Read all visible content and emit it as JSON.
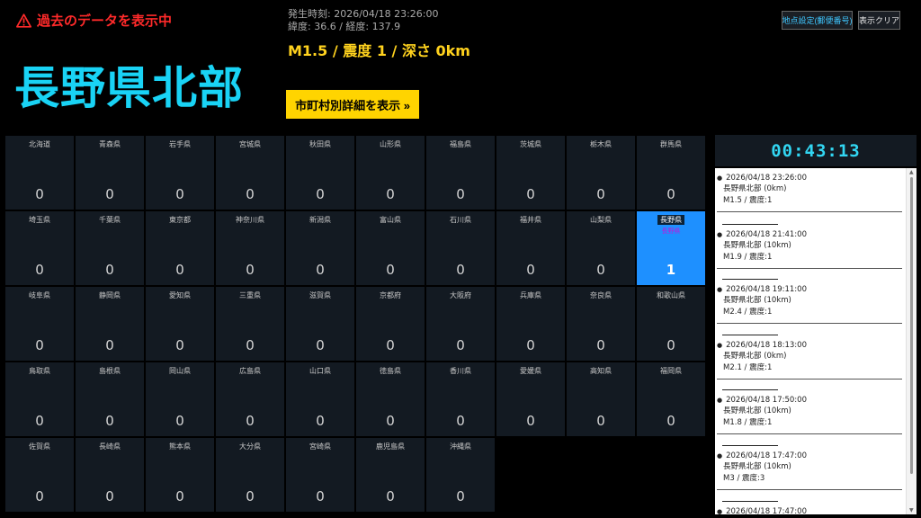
{
  "header": {
    "warning": "過去のデータを表示中",
    "region_title": "長野県北部",
    "time_line": "発生時刻: 2026/04/18 23:26:00",
    "coord_line": "緯度: 36.6 / 経度: 137.9",
    "quake_line": "M1.5 / 震度 1 / 深さ 0km",
    "detail_button": "市町村別詳細を表示 »",
    "postal_button": "地点設定(郵便番号)",
    "clear_button": "表示クリア"
  },
  "grid": [
    {
      "name": "北海道",
      "count": "0"
    },
    {
      "name": "青森県",
      "count": "0"
    },
    {
      "name": "岩手県",
      "count": "0"
    },
    {
      "name": "宮城県",
      "count": "0"
    },
    {
      "name": "秋田県",
      "count": "0"
    },
    {
      "name": "山形県",
      "count": "0"
    },
    {
      "name": "福島県",
      "count": "0"
    },
    {
      "name": "茨城県",
      "count": "0"
    },
    {
      "name": "栃木県",
      "count": "0"
    },
    {
      "name": "群馬県",
      "count": "0"
    },
    {
      "name": "埼玉県",
      "count": "0"
    },
    {
      "name": "千葉県",
      "count": "0"
    },
    {
      "name": "東京都",
      "count": "0"
    },
    {
      "name": "神奈川県",
      "count": "0"
    },
    {
      "name": "新潟県",
      "count": "0"
    },
    {
      "name": "富山県",
      "count": "0"
    },
    {
      "name": "石川県",
      "count": "0"
    },
    {
      "name": "福井県",
      "count": "0"
    },
    {
      "name": "山梨県",
      "count": "0"
    },
    {
      "name": "長野県",
      "count": "1",
      "sub": "長野県",
      "highlight": true
    },
    {
      "name": "岐阜県",
      "count": "0"
    },
    {
      "name": "静岡県",
      "count": "0"
    },
    {
      "name": "愛知県",
      "count": "0"
    },
    {
      "name": "三重県",
      "count": "0"
    },
    {
      "name": "滋賀県",
      "count": "0"
    },
    {
      "name": "京都府",
      "count": "0"
    },
    {
      "name": "大阪府",
      "count": "0"
    },
    {
      "name": "兵庫県",
      "count": "0"
    },
    {
      "name": "奈良県",
      "count": "0"
    },
    {
      "name": "和歌山県",
      "count": "0"
    },
    {
      "name": "鳥取県",
      "count": "0"
    },
    {
      "name": "島根県",
      "count": "0"
    },
    {
      "name": "岡山県",
      "count": "0"
    },
    {
      "name": "広島県",
      "count": "0"
    },
    {
      "name": "山口県",
      "count": "0"
    },
    {
      "name": "徳島県",
      "count": "0"
    },
    {
      "name": "香川県",
      "count": "0"
    },
    {
      "name": "愛媛県",
      "count": "0"
    },
    {
      "name": "高知県",
      "count": "0"
    },
    {
      "name": "福岡県",
      "count": "0"
    },
    {
      "name": "佐賀県",
      "count": "0"
    },
    {
      "name": "長崎県",
      "count": "0"
    },
    {
      "name": "熊本県",
      "count": "0"
    },
    {
      "name": "大分県",
      "count": "0"
    },
    {
      "name": "宮崎県",
      "count": "0"
    },
    {
      "name": "鹿児島県",
      "count": "0"
    },
    {
      "name": "沖縄県",
      "count": "0"
    }
  ],
  "timer": "00:43:13",
  "log": [
    {
      "time": "2026/04/18 23:26:00",
      "place": "長野県北部 (0km)",
      "info": "M1.5 / 震度:1"
    },
    {
      "time": "2026/04/18 21:41:00",
      "place": "長野県北部 (10km)",
      "info": "M1.9 / 震度:1"
    },
    {
      "time": "2026/04/18 19:11:00",
      "place": "長野県北部 (10km)",
      "info": "M2.4 / 震度:1"
    },
    {
      "time": "2026/04/18 18:13:00",
      "place": "長野県北部 (0km)",
      "info": "M2.1 / 震度:1"
    },
    {
      "time": "2026/04/18 17:50:00",
      "place": "長野県北部 (10km)",
      "info": "M1.8 / 震度:1"
    },
    {
      "time": "2026/04/18 17:47:00",
      "place": "長野県北部 (10km)",
      "info": "M3 / 震度:3"
    },
    {
      "time": "2026/04/18 17:47:00",
      "place": "",
      "info": ""
    }
  ],
  "colors": {
    "warning": "#ff2a2a",
    "title": "#19d3f5",
    "quake": "#ffd21e",
    "highlight_cell": "#1e90ff",
    "timer": "#32d6f2"
  }
}
